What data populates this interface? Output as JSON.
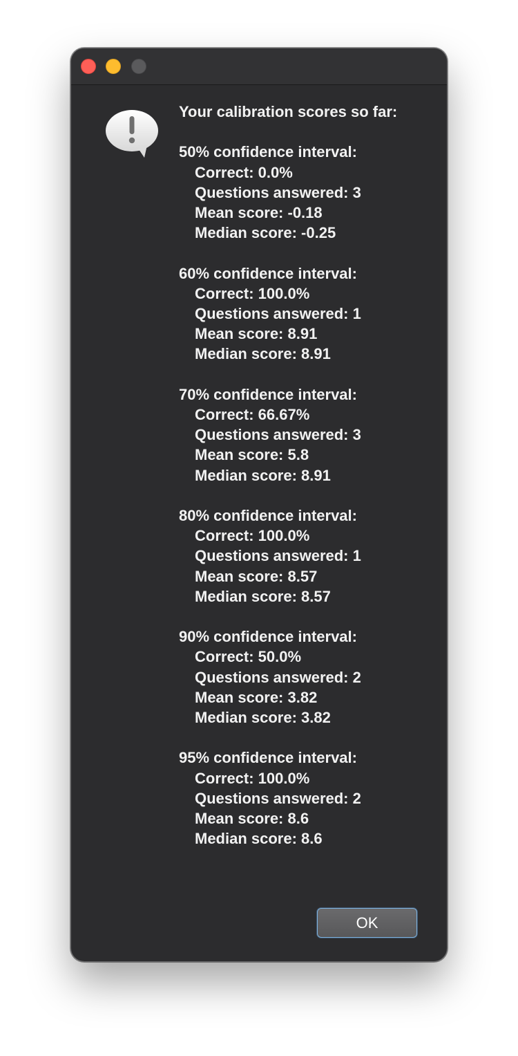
{
  "dialog": {
    "heading": "Your calibration scores so far:",
    "sections": [
      {
        "title": "50% confidence interval:",
        "correct": "Correct: 0.0%",
        "answered": "Questions answered: 3",
        "mean": "Mean score: -0.18",
        "median": "Median score: -0.25"
      },
      {
        "title": "60% confidence interval:",
        "correct": "Correct: 100.0%",
        "answered": "Questions answered: 1",
        "mean": "Mean score: 8.91",
        "median": "Median score: 8.91"
      },
      {
        "title": "70% confidence interval:",
        "correct": "Correct: 66.67%",
        "answered": "Questions answered: 3",
        "mean": "Mean score: 5.8",
        "median": "Median score: 8.91"
      },
      {
        "title": "80% confidence interval:",
        "correct": "Correct: 100.0%",
        "answered": "Questions answered: 1",
        "mean": "Mean score: 8.57",
        "median": "Median score: 8.57"
      },
      {
        "title": "90% confidence interval:",
        "correct": "Correct: 50.0%",
        "answered": "Questions answered: 2",
        "mean": "Mean score: 3.82",
        "median": "Median score: 3.82"
      },
      {
        "title": "95% confidence interval:",
        "correct": "Correct: 100.0%",
        "answered": "Questions answered: 2",
        "mean": "Mean score: 8.6",
        "median": "Median score: 8.6"
      }
    ],
    "ok_label": "OK",
    "icon": "alert-speech-bubble-icon"
  },
  "window_controls": {
    "close_color": "#fe5f57",
    "minimize_color": "#febc2e",
    "zoom_color": "#5a5a5c"
  },
  "colors": {
    "window_bg": "#2c2c2e",
    "text": "#f2f2f2",
    "button_border": "#7fb3df"
  }
}
